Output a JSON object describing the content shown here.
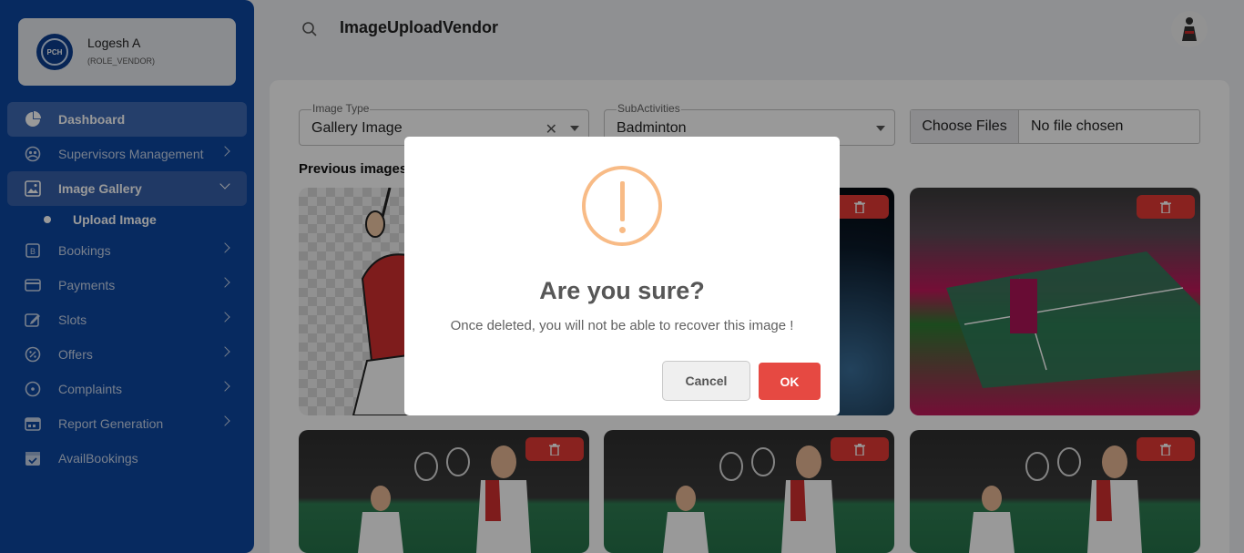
{
  "user": {
    "name": "Logesh A",
    "role": "(ROLE_VENDOR)",
    "avatar_text": "PCH"
  },
  "header": {
    "title": "ImageUploadVendor"
  },
  "sidebar": {
    "items": [
      {
        "label": "Dashboard",
        "icon": "pie-chart-icon"
      },
      {
        "label": "Supervisors Management",
        "icon": "supervisor-icon"
      },
      {
        "label": "Image Gallery",
        "icon": "gallery-icon"
      },
      {
        "label": "Bookings",
        "icon": "bookings-icon"
      },
      {
        "label": "Payments",
        "icon": "card-icon"
      },
      {
        "label": "Slots",
        "icon": "edit-calendar-icon"
      },
      {
        "label": "Offers",
        "icon": "discount-icon"
      },
      {
        "label": "Complaints",
        "icon": "circle-dot-icon"
      },
      {
        "label": "Report Generation",
        "icon": "report-calendar-icon"
      },
      {
        "label": "AvailBookings",
        "icon": "check-calendar-icon"
      }
    ],
    "subitem": {
      "label": "Upload Image"
    }
  },
  "form": {
    "image_type": {
      "label": "Image Type",
      "value": "Gallery Image"
    },
    "sub_activities": {
      "label": "SubActivities",
      "value": "Badminton"
    },
    "file": {
      "button": "Choose Files",
      "status": "No file chosen"
    }
  },
  "gallery": {
    "title": "Previous images"
  },
  "modal": {
    "title": "Are you sure?",
    "text": "Once deleted, you will not be able to recover this image !",
    "cancel": "Cancel",
    "ok": "OK"
  },
  "colors": {
    "sidebar": "#0d47a1",
    "danger": "#e53935",
    "warning": "#f8bb86"
  }
}
